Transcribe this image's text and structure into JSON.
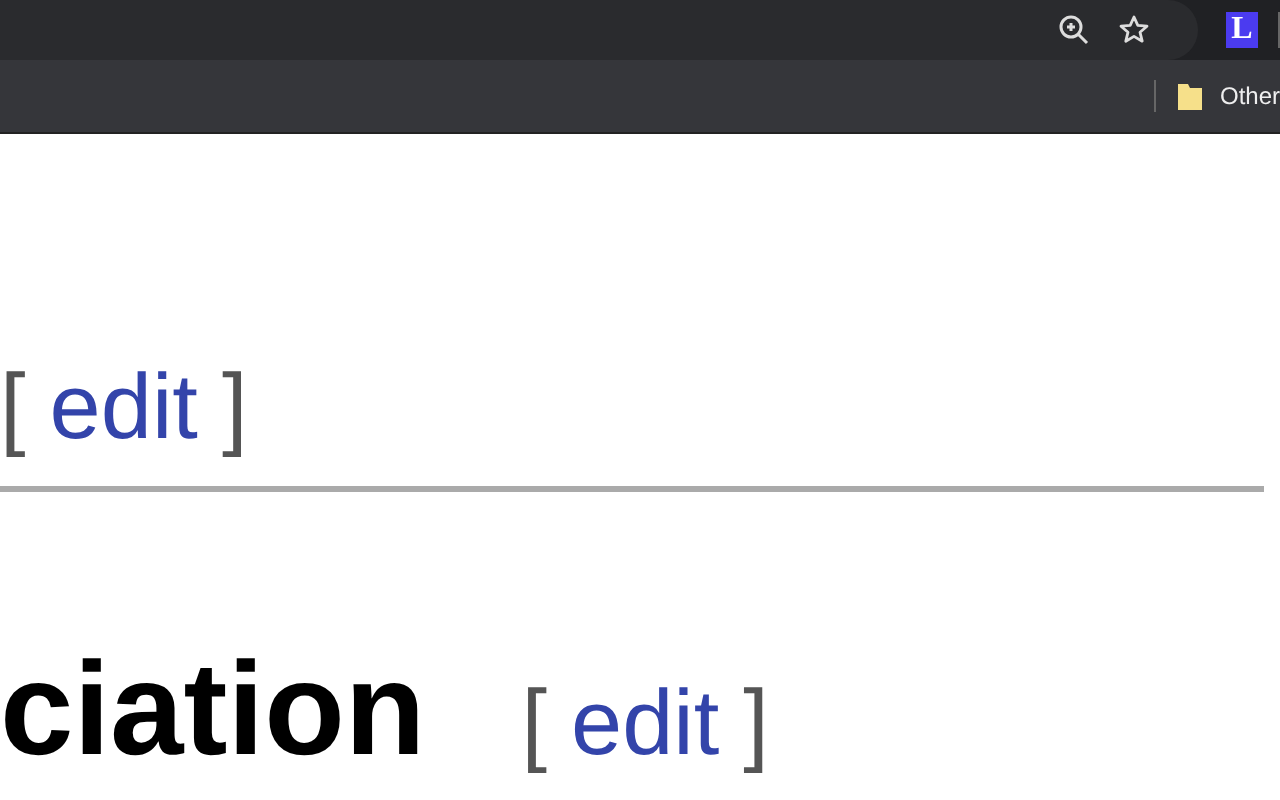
{
  "toolbar": {
    "extension_letter": "L"
  },
  "bookmarks_bar": {
    "folders": [
      {
        "label": "Other"
      }
    ]
  },
  "sections": [
    {
      "edit": {
        "open": "[",
        "label": "edit",
        "close": "]"
      }
    },
    {
      "heading": "ciation",
      "edit": {
        "open": "[",
        "label": "edit",
        "close": "]"
      }
    }
  ]
}
